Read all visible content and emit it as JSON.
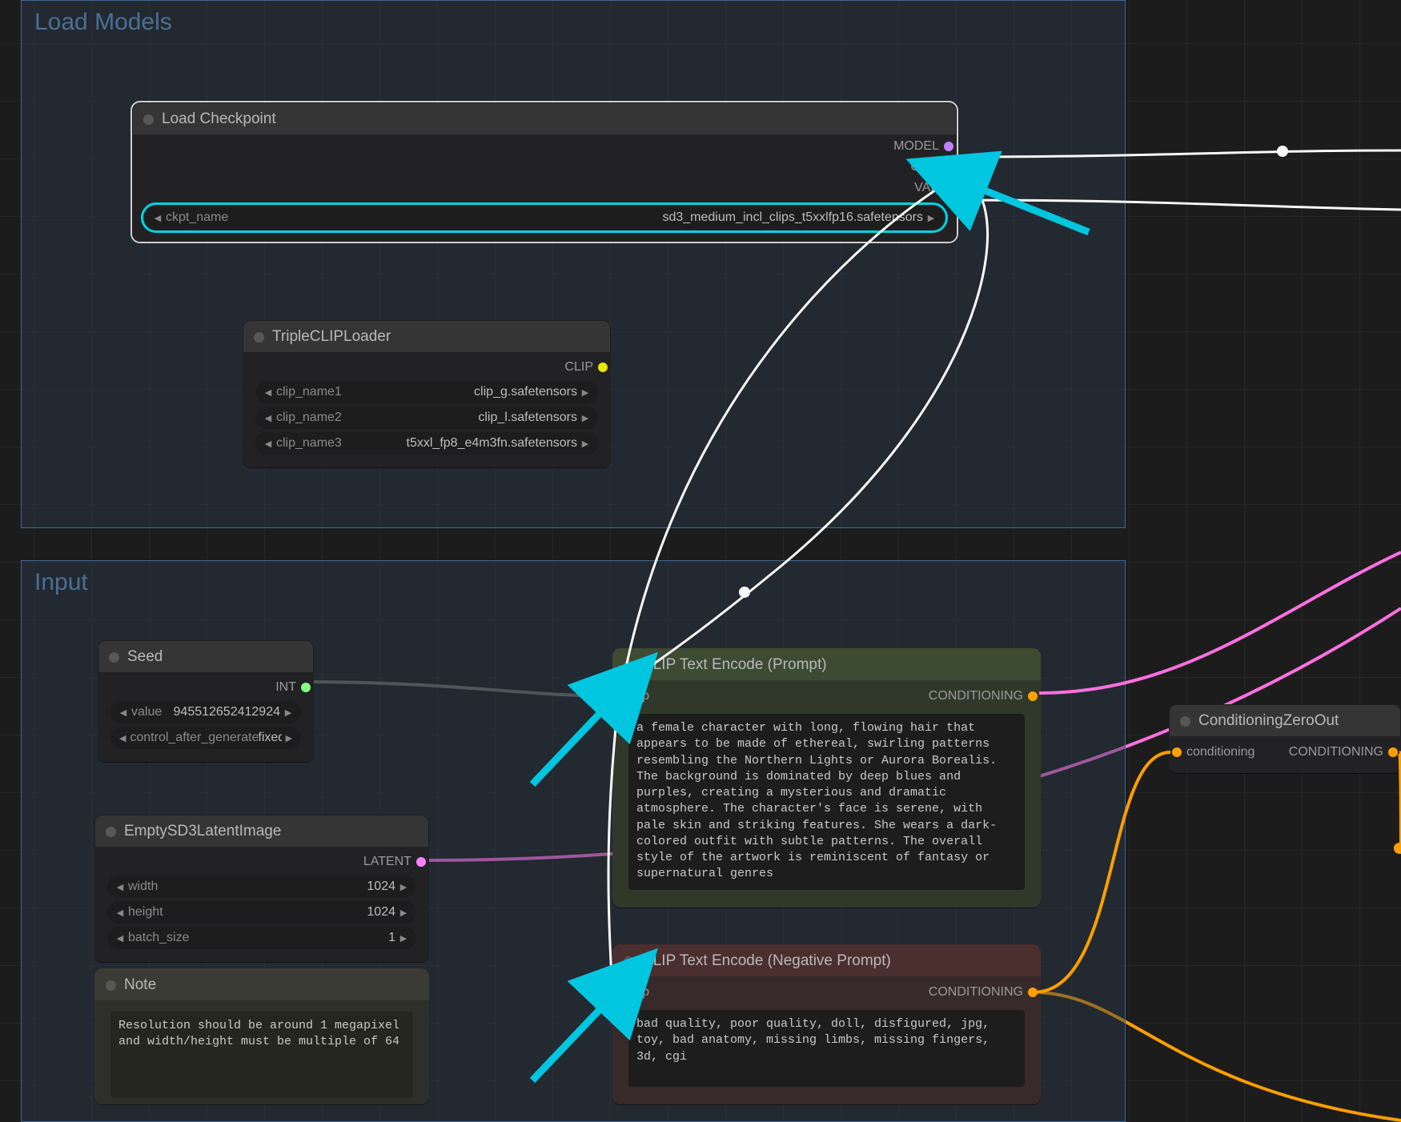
{
  "groups": {
    "load_models": {
      "title": "Load Models"
    },
    "input": {
      "title": "Input"
    }
  },
  "nodes": {
    "load_checkpoint": {
      "title": "Load Checkpoint",
      "out": {
        "model": "MODEL",
        "clip": "CLIP",
        "vae": "VAE"
      },
      "ckpt_name_label": "ckpt_name",
      "ckpt_name_value": "sd3_medium_incl_clips_t5xxlfp16.safetensors"
    },
    "triple_clip": {
      "title": "TripleCLIPLoader",
      "out": {
        "clip": "CLIP"
      },
      "rows": [
        {
          "label": "clip_name1",
          "value": "clip_g.safetensors"
        },
        {
          "label": "clip_name2",
          "value": "clip_l.safetensors"
        },
        {
          "label": "clip_name3",
          "value": "t5xxl_fp8_e4m3fn.safetensors"
        }
      ]
    },
    "seed": {
      "title": "Seed",
      "out": {
        "int": "INT"
      },
      "rows": [
        {
          "label": "value",
          "value": "945512652412924"
        },
        {
          "label": "control_after_generate",
          "value": "fixed"
        }
      ]
    },
    "empty_latent": {
      "title": "EmptySD3LatentImage",
      "out": {
        "latent": "LATENT"
      },
      "rows": [
        {
          "label": "width",
          "value": "1024"
        },
        {
          "label": "height",
          "value": "1024"
        },
        {
          "label": "batch_size",
          "value": "1"
        }
      ]
    },
    "note": {
      "title": "Note",
      "text": "Resolution should be around 1 megapixel and width/height must be multiple of 64"
    },
    "clip_pos": {
      "title": "CLIP Text Encode (Prompt)",
      "in": {
        "clip": "clip"
      },
      "out": {
        "cond": "CONDITIONING"
      },
      "text": "a female character with long, flowing hair that appears to be made of ethereal, swirling patterns resembling the Northern Lights or Aurora Borealis. The background is dominated by deep blues and purples, creating a mysterious and dramatic atmosphere. The character's face is serene, with pale skin and striking features. She wears a dark-colored outfit with subtle patterns. The overall style of the artwork is reminiscent of fantasy or supernatural genres"
    },
    "clip_neg": {
      "title": "CLIP Text Encode (Negative Prompt)",
      "in": {
        "clip": "clip"
      },
      "out": {
        "cond": "CONDITIONING"
      },
      "text": "bad quality, poor quality, doll, disfigured, jpg, toy, bad anatomy, missing limbs, missing fingers, 3d, cgi"
    },
    "cond_zero": {
      "title": "ConditioningZeroOut",
      "in": {
        "cond": "conditioning"
      },
      "out": {
        "cond": "CONDITIONING"
      }
    }
  }
}
